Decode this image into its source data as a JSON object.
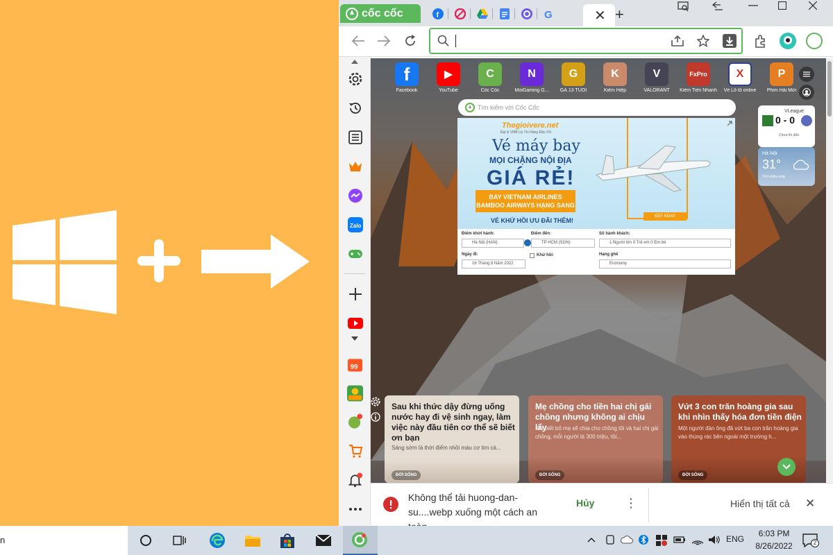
{
  "browser": {
    "brand_tab_label": "cốc cốc",
    "address_value": "",
    "newtab_label": "+",
    "tab_close_label": "✕"
  },
  "shortcuts": [
    {
      "label": "Facebook",
      "icon": "facebook-icon",
      "text": "f",
      "color": "#1877f2"
    },
    {
      "label": "YouTube",
      "icon": "youtube-icon",
      "text": "▶",
      "color": "#ff0000"
    },
    {
      "label": "Cốc Cốc",
      "icon": "coccoc-icon",
      "text": "C",
      "color": "#6ab04c"
    },
    {
      "label": "MoiGaming G...",
      "icon": "moigaming-icon",
      "text": "N",
      "color": "#6a2ad8"
    },
    {
      "label": "GÀ 13 TUỔI",
      "icon": "ga13-icon",
      "text": "G",
      "color": "#d4a017"
    },
    {
      "label": "Kiếm Hiệp",
      "icon": "kiemhiep-icon",
      "text": "K",
      "color": "#c98b6b"
    },
    {
      "label": "VALORANT",
      "icon": "valorant-icon",
      "text": "V",
      "color": "#444455"
    },
    {
      "label": "Kiếm Tiền Nhanh",
      "icon": "fxpro-icon",
      "text": "FxPro",
      "color": "#c0392b"
    },
    {
      "label": "Vé Lô tô online",
      "icon": "veloto-icon",
      "text": "X",
      "color": "#ffffff"
    },
    {
      "label": "Phim Hài Mới",
      "icon": "phimhai-icon",
      "text": "P",
      "color": "#e67e22"
    }
  ],
  "search": {
    "placeholder": "Tìm kiếm với Cốc Cốc"
  },
  "ad": {
    "site": "Thegioivere.net",
    "site_sub": "Đại lý VMB Uy Tín Hàng Đầu VN",
    "headline1": "Vé máy bay",
    "headline2": "MỌI CHẶNG NỘI ĐỊA",
    "headline3": "GIÁ RẺ!",
    "banner_line1": "BAY VIETNAM AIRLINES",
    "banner_line2": "BAMBOO AIRWAYS HẠNG SANG",
    "headline4": "VÉ KHỨ HỒI ƯU ĐÃI THÊM!",
    "cta": "ĐẶT NGAY",
    "form": {
      "from_label": "Điểm khởi hành:",
      "from_value": "Hà Nội (HAN)",
      "to_label": "Điểm đến:",
      "to_value": "TP HCM (SGN)",
      "pax_label": "Số hành khách:",
      "pax_value": "1 Người lớn  0 Trẻ em  0 Em bé",
      "date_label": "Ngày đi:",
      "date_value": "16 Tháng 8 Năm 2022",
      "roundtrip_label": "Khứ hồi:",
      "class_label": "Hạng ghế",
      "class_value": "Economy"
    }
  },
  "widgets": {
    "league_name": "VLeague",
    "score": "0 - 0",
    "match_status": "Chưa thi đấu",
    "weather_city": "Hà Nội",
    "weather_temp": "31°",
    "weather_desc": "Trời nhiều mây"
  },
  "news": [
    {
      "title": "Sau khi thức dậy đừng uống nước hay đi vệ sinh ngay, làm việc này đầu tiên cơ thể sẽ biết ơn bạn",
      "desc": "Sáng sớm là thời điểm nhồi máu cơ tim cả...",
      "tag": "ĐỜI SỐNG"
    },
    {
      "title": "Mẹ chồng cho tiền hai chị gái chồng nhưng không ai chịu lấy",
      "desc": "Khi biết bố mẹ sẽ chia cho chồng tôi và hai chị gái chồng, mỗi người là 300 triệu, tôi...",
      "tag": "ĐỜI SỐNG"
    },
    {
      "title": "Vứt 3 con trăn hoàng gia sau khi nhìn thấy hóa đơn tiền điện",
      "desc": "Một người đàn ông đã vứt ba con trăn hoàng gia vào thùng rác bên ngoài một trường h...",
      "tag": "ĐỜI SỐNG"
    }
  ],
  "download": {
    "message": "Không thể tải huong-dan-su....webp xuống một cách an toàn",
    "cancel": "Hủy",
    "show_all": "Hiển thị tất cả",
    "more": "⋮",
    "close": "✕"
  },
  "taskbar": {
    "lang": "ENG",
    "time": "6:03 PM",
    "date": "8/26/2022",
    "notif_count": "2",
    "search_fragment": "n"
  },
  "colors": {
    "accent": "#5cb85c",
    "taskbar": "#d5dde6",
    "background": "#ffb84d"
  }
}
